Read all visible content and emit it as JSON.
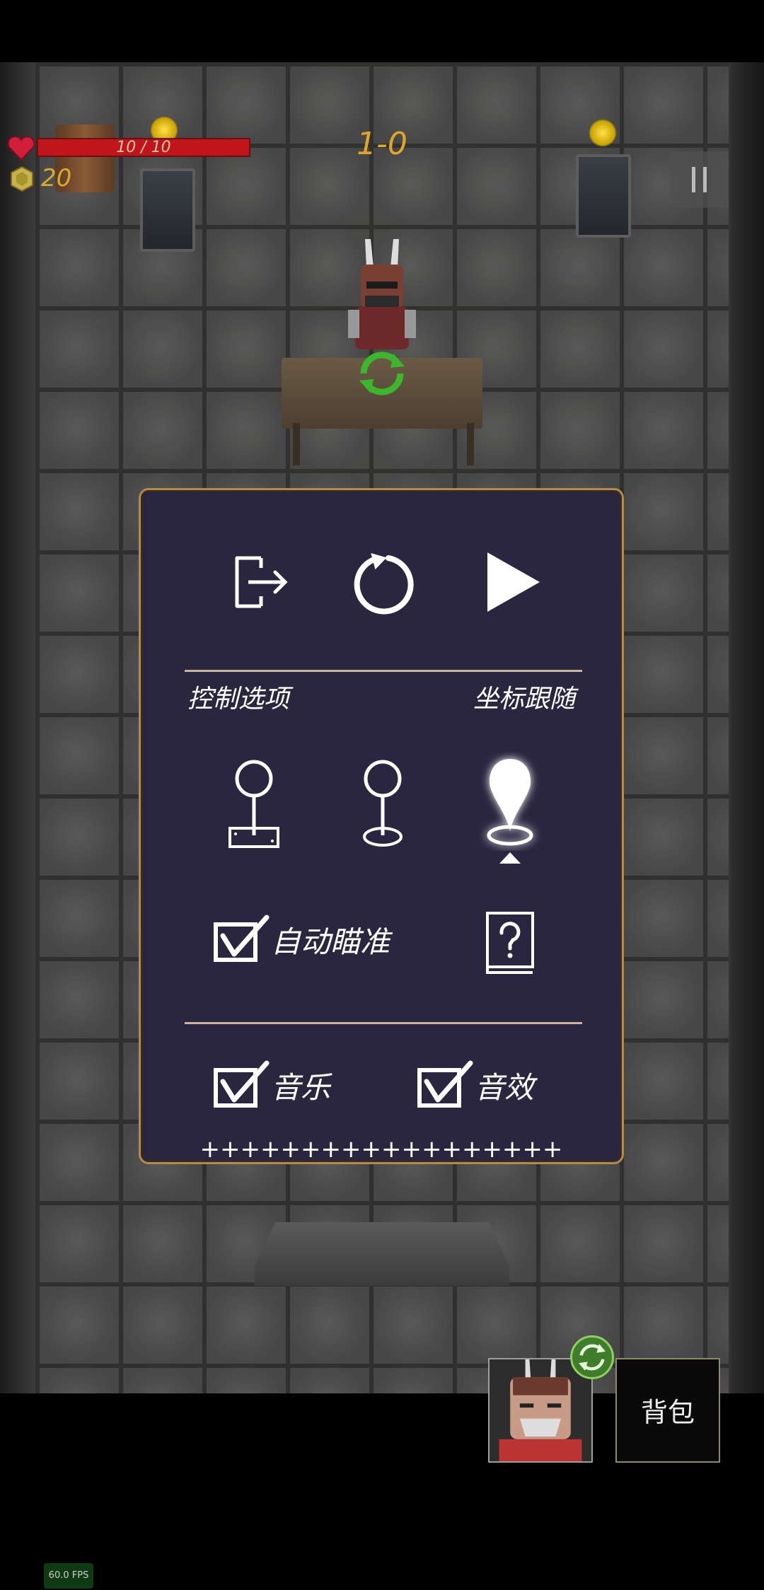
{
  "hud": {
    "hp": "10 / 10",
    "coins": "20",
    "level": "1-0"
  },
  "panel": {
    "control_options_label": "控制选项",
    "coordinate_follow_label": "坐标跟随",
    "auto_aim_label": "自动瞄准",
    "music_label": "音乐",
    "sound_effects_label": "音效",
    "volume_bar": "++++++++++++++++++",
    "auto_aim_checked": true,
    "music_checked": true,
    "sound_effects_checked": true,
    "selected_control_mode": "coordinate-follow"
  },
  "bag_label": "背包",
  "fps": "60.0 FPS",
  "colors": {
    "panel_bg": "#2a2640",
    "panel_border": "#b58a4a",
    "hp_red": "#c0151b",
    "gold": "#e0a52c"
  }
}
